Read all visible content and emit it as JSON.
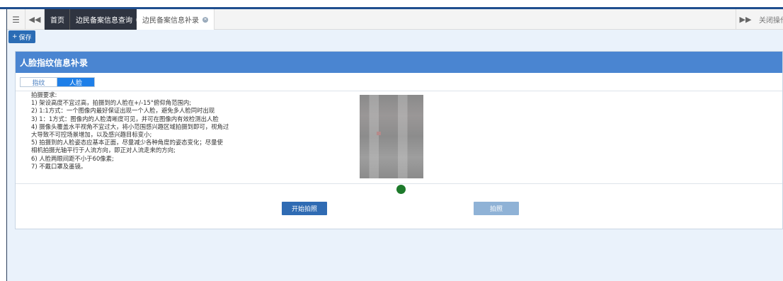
{
  "tabbar": {
    "menu_icon": "hamburger-icon",
    "back_icon": "double-left-icon",
    "forward_icon": "double-right-icon",
    "tabs": [
      {
        "label": "首页",
        "active": true,
        "closable": false
      },
      {
        "label": "边民备案信息查询",
        "active": true,
        "closable": true
      },
      {
        "label": "边民备案信息补录",
        "active": false,
        "closable": true
      }
    ],
    "close_ops_label": "关闭操作"
  },
  "toolbar": {
    "save_label": "保存"
  },
  "panel": {
    "title": "人脸指纹信息补录",
    "subtabs": [
      {
        "label": "指纹",
        "active": false
      },
      {
        "label": "人脸",
        "active": true
      }
    ],
    "requirements": [
      "拍摄要求:",
      "1) 架设高度不宜过高，拍摄到的人脸在+/-15°俯仰角范围内;",
      "2) 1:1方式：一个图像内最好保证出现一个人脸，避免多人脸同时出现",
      "3) 1：1方式：图像内的人脸清晰度可见，并可在图像内有效检测出人脸",
      "4) 摄像头覆盖水平视角不宜过大，将小范围感兴趣区域拍摄到即可，视角过",
      "大导致不可控场景增加，以及感兴趣目标变小;",
      "5) 拍摄到的人脸姿态应基本正面，尽量减少各种角度的姿态变化；尽量使",
      "相机拍摄光轴平行于人流方向，即正对人流走来的方向;",
      "6) 人脸两眼间距不小于60像素;",
      "7) 不戴口罩及墨镜。"
    ],
    "start_button_label": "开始拍照",
    "capture_button_label": "拍照",
    "status_color": "#1d7a2b"
  },
  "colors": {
    "accent": "#4a85d1",
    "dark_tab": "#2f3440",
    "primary_button": "#2f6bb3",
    "disabled_button": "#8fb2d6"
  }
}
